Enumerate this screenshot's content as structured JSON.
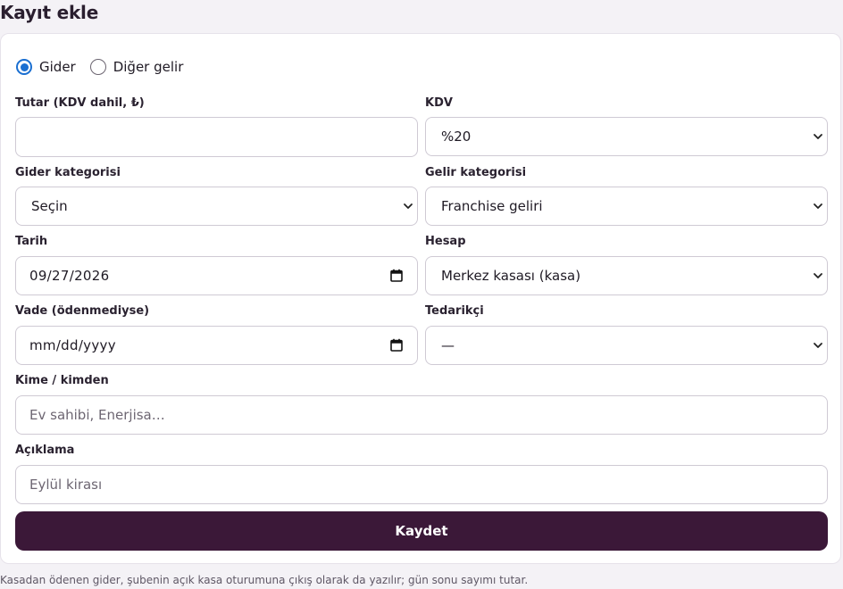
{
  "page": {
    "title": "Kayıt ekle"
  },
  "type_selector": {
    "options": [
      {
        "label": "Gider",
        "checked": true
      },
      {
        "label": "Diğer gelir",
        "checked": false
      }
    ]
  },
  "form": {
    "amount": {
      "label": "Tutar (KDV dahil, ₺)",
      "value": ""
    },
    "vat": {
      "label": "KDV",
      "selected": "%20"
    },
    "expense_category": {
      "label": "Gider kategorisi",
      "selected": "Seçin"
    },
    "income_category": {
      "label": "Gelir kategorisi",
      "selected": "Franchise geliri"
    },
    "date": {
      "label": "Tarih",
      "value": "09/27/2026"
    },
    "account": {
      "label": "Hesap",
      "selected": "Merkez kasası (kasa)"
    },
    "due_date": {
      "label": "Vade (ödenmediyse)",
      "placeholder": "mm/dd/yyyy"
    },
    "supplier": {
      "label": "Tedarikçi",
      "selected": "—"
    },
    "counterparty": {
      "label": "Kime / kimden",
      "placeholder": "Ev sahibi, Enerjisa…"
    },
    "description": {
      "label": "Açıklama",
      "placeholder": "Eylül kirası"
    }
  },
  "actions": {
    "save_label": "Kaydet"
  },
  "footer": {
    "note": "Kasadan ödenen gider, şubenin açık kasa oturumuna çıkış olarak da yazılır; gün sonu sayımı tutar."
  },
  "colors": {
    "accent": "#1a6fd1",
    "button": "#3b1838",
    "background": "#f4f2f6"
  }
}
